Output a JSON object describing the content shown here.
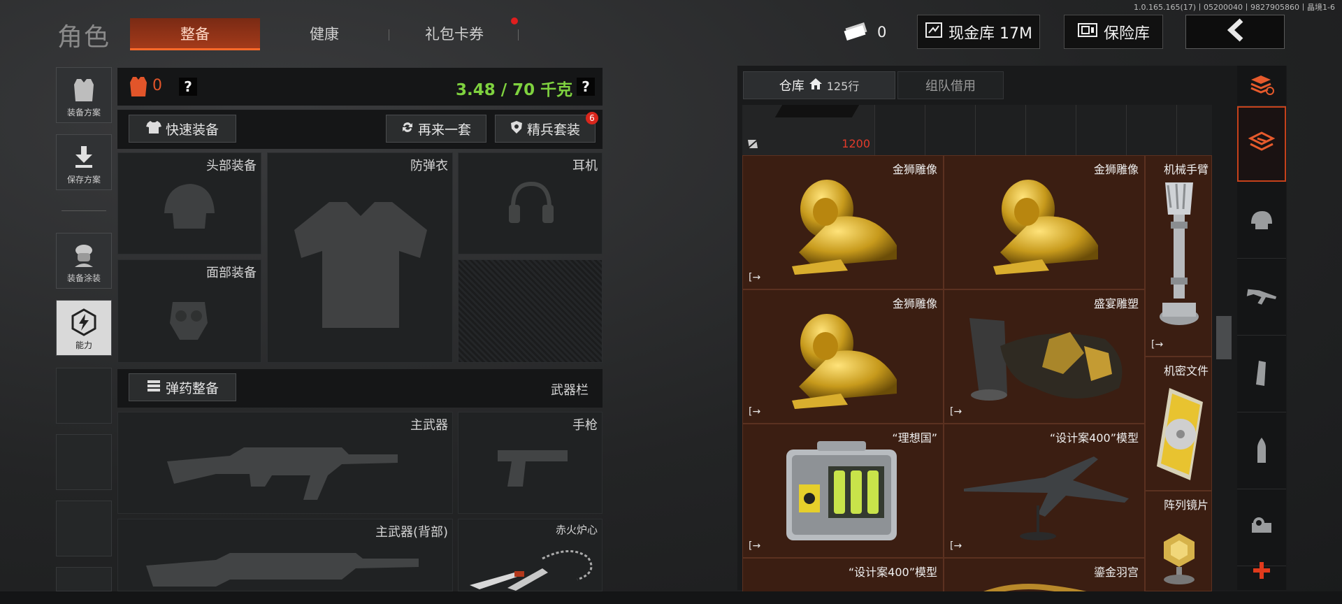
{
  "version": "1.0.165.165(17)丨05200040丨9827905860丨晶境1-6",
  "title": "角色",
  "tabs": {
    "equip": "整备",
    "health": "健康",
    "gift": "礼包卡券"
  },
  "hud": {
    "cash_count": "0",
    "cash_vault": "现金库 17M",
    "safe": "保险库"
  },
  "sidebar": {
    "plan": "装备方案",
    "save": "保存方案",
    "skin": "装备涂装",
    "ability": "能力"
  },
  "stats": {
    "armor_value": "0",
    "help": "?",
    "weight": "3.48 / 70 千克"
  },
  "actions": {
    "quick_equip": "快速装备",
    "another_set": "再来一套",
    "elite_set": "精兵套装",
    "elite_badge": "6"
  },
  "slots": {
    "head": "头部装备",
    "vest": "防弹衣",
    "headset": "耳机",
    "face": "面部装备",
    "ammo_equip": "弹药整备",
    "weapon_bar": "武器栏",
    "primary": "主武器",
    "pistol": "手枪",
    "primary_back": "主武器(背部)",
    "melee": "赤火炉心"
  },
  "warehouse": {
    "tab_label": "仓库",
    "rows": "125行",
    "team_lend": "组队借用",
    "top_price": "1200",
    "items": [
      {
        "name": "金狮雕像"
      },
      {
        "name": "金狮雕像"
      },
      {
        "name": "机械手臂"
      },
      {
        "name": "金狮雕像"
      },
      {
        "name": "盛宴雕塑"
      },
      {
        "name": "机密文件"
      },
      {
        "name": "“理想国”"
      },
      {
        "name": "“设计案400”模型"
      },
      {
        "name": "阵列镜片"
      },
      {
        "name": "“设计案400”模型"
      },
      {
        "name": "鎏金羽宫"
      }
    ]
  },
  "colors": {
    "accent": "#c5411b",
    "weight_green": "#7fd23f",
    "cell_bg": "#3b1e12",
    "price_red": "#e23b2b"
  }
}
